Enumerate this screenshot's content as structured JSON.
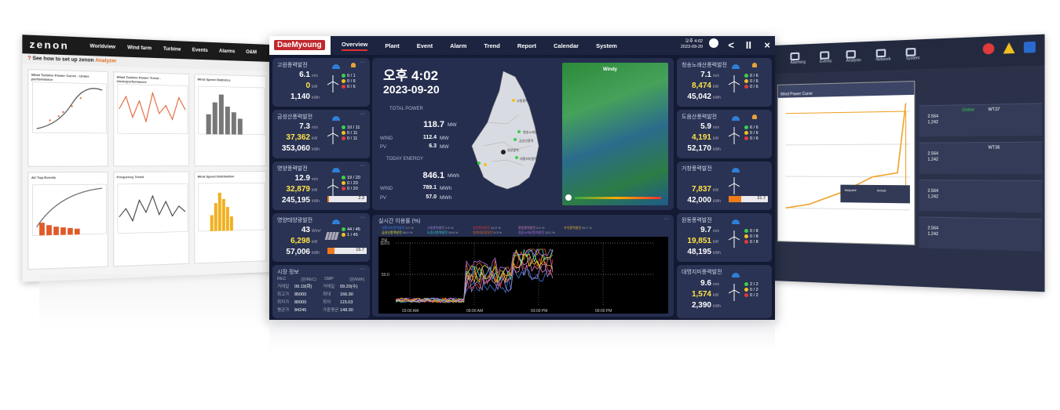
{
  "left_screen": {
    "logo": "zenon",
    "nav": [
      "Worldview",
      "Wind farm",
      "Turbine",
      "Events",
      "Alarms",
      "O&M"
    ],
    "subtitle": "See how to set up zenon",
    "subtitle_link": "Analyzer",
    "panels": [
      "Wind Turbine Power Curve - Under performance",
      "Wind Turbine Power Trend - Underperformance",
      "Wind Speed Statistics",
      "AV Top Events",
      "Frequency Trend",
      "Wind Speed Distribution"
    ]
  },
  "main": {
    "brand": "DaeMyoung",
    "nav": [
      "Overview",
      "Plant",
      "Event",
      "Alarm",
      "Trend",
      "Report",
      "Calendar",
      "System"
    ],
    "clock": {
      "time": "오후 4:02",
      "date": "2023-09-20"
    },
    "controls": {
      "back": "<",
      "pause": "II",
      "close": "×"
    },
    "left_cards": [
      {
        "name": "고원풍력발전",
        "v1": "6.1",
        "u1": "m/s",
        "v2": "0",
        "u2": "kW",
        "v3": "1,140",
        "u3": "kWh",
        "c": [
          "0",
          "0",
          "0"
        ],
        "t": [
          "1",
          "6",
          "6"
        ]
      },
      {
        "name": "금성산풍력발전",
        "v1": "7.3",
        "u1": "m/s",
        "v2": "37,362",
        "u2": "kW",
        "v3": "353,060",
        "u3": "kWh",
        "c": [
          "10",
          "0",
          "0"
        ],
        "t": [
          "11",
          "11",
          "11"
        ]
      },
      {
        "name": "영양풍력발전",
        "v1": "12.9",
        "u1": "m/s",
        "v2": "32,879",
        "u2": "kW",
        "v3": "245,195",
        "u3": "kWh",
        "c": [
          "19",
          "0",
          "0"
        ],
        "t": [
          "20",
          "20",
          "20"
        ],
        "bar": "2.3"
      },
      {
        "name": "영양태양광발전",
        "v1": "43",
        "u1": "W/m²",
        "v2": "6,298",
        "u2": "kW",
        "v3": "57,006",
        "u3": "kWh",
        "c": [
          "44",
          "1"
        ],
        "t": [
          "45",
          "45"
        ],
        "bar": "16.7"
      }
    ],
    "market": {
      "title": "시장 정보",
      "rec": "REC",
      "smp": "SMP",
      "rec_unit": "(원/REC)",
      "smp_unit": "(원/kWh)",
      "rows": [
        {
          "k1": "거래일",
          "v1": "09.19(화)",
          "k2": "거래일",
          "v2": "09.20(수)"
        },
        {
          "k1": "최고가",
          "v1": "85000",
          "k2": "최대",
          "v2": "166.90"
        },
        {
          "k1": "최저가",
          "v1": "80000",
          "k2": "최저",
          "v2": "115.03"
        },
        {
          "k1": "평균가",
          "v1": "84245",
          "k2": "가중평균",
          "v2": "148.90"
        }
      ]
    },
    "center": {
      "time": "오후 4:02",
      "date": "2023-09-20",
      "total_power_label": "TOTAL POWER",
      "total_power": "118.7",
      "total_power_unit": "MW",
      "wind_label": "WIND",
      "wind_power": "112.4",
      "wind_power_unit": "MW",
      "pv_label": "PV",
      "pv_power": "6.3",
      "pv_power_unit": "MW",
      "today_energy_label": "TODAY ENERGY",
      "today_energy": "846.1",
      "today_energy_unit": "MWh",
      "wind_energy": "789.1",
      "wind_energy_unit": "MWh",
      "pv_energy": "57.0",
      "pv_energy_unit": "MWh",
      "map_labels": [
        "고원풍력",
        "청송노래산풍력",
        "금성산풍력",
        "영양풍력",
        "대명지미풍력",
        "태양광"
      ],
      "weather_brand": "Windy"
    },
    "trend": {
      "title": "실시간 이용률 (%)",
      "legend": [
        {
          "name": "대명지미풍력발전",
          "value": "0.1 %",
          "color": "#3a7be0"
        },
        {
          "name": "고원풍력발전",
          "value": "2.6 %",
          "color": "#a58be0"
        },
        {
          "name": "영양풍력발전",
          "value": "42.2 %",
          "color": "#e03a3a"
        },
        {
          "name": "풍동풍력발전",
          "value": "5.0 %",
          "color": "#e080c0"
        },
        {
          "name": "가덕풍력발전",
          "value": "26.7 %",
          "color": "#f0b830"
        },
        {
          "name": "금성산풍력발전",
          "value": "46.0 %",
          "color": "#e8e830"
        },
        {
          "name": "도음산풍력발전",
          "value": "19.6 %",
          "color": "#3ad0d0"
        },
        {
          "name": "영양태양광발전",
          "value": "9.3 %",
          "color": "#e06a20"
        },
        {
          "name": "청송노래산풍력발전",
          "value": "15.1 %",
          "color": "#b070e0"
        }
      ],
      "y_unit": "[%]",
      "y_ticks": [
        "110.0",
        "50.0"
      ],
      "x_ticks": [
        "03:00 AM",
        "09:00 AM",
        "03:00 PM",
        "09:00 PM"
      ]
    },
    "right_cards": [
      {
        "name": "청송노래산풍력발전",
        "v1": "7.1",
        "u1": "m/s",
        "v2": "8,474",
        "u2": "kW",
        "v3": "45,042",
        "u3": "kWh",
        "c": [
          "0",
          "0",
          "0"
        ],
        "t": [
          "6",
          "6",
          "6"
        ]
      },
      {
        "name": "도음산풍력발전",
        "v1": "5.9",
        "u1": "m/s",
        "v2": "4,191",
        "u2": "kW",
        "v3": "52,170",
        "u3": "kWh",
        "c": [
          "6",
          "0",
          "0"
        ],
        "t": [
          "6",
          "6",
          "6"
        ]
      },
      {
        "name": "거창풍력발전",
        "v2": "7,837",
        "u2": "kW",
        "v3": "42,000",
        "u3": "kWh",
        "bar": "31.7"
      },
      {
        "name": "원동풍력발전",
        "v1": "9.7",
        "u1": "m/s",
        "v2": "19,851",
        "u2": "kW",
        "v3": "48,195",
        "u3": "kWh",
        "c": [
          "0",
          "0",
          "0"
        ],
        "t": [
          "8",
          "8",
          "8"
        ]
      },
      {
        "name": "대명지미풍력발전",
        "v1": "9.6",
        "u1": "m/s",
        "v2": "1,574",
        "u2": "kW",
        "v3": "2,390",
        "u3": "kWh",
        "c": [
          "2",
          "0",
          "0"
        ],
        "t": [
          "2",
          "2",
          "2"
        ]
      }
    ]
  },
  "right_screen": {
    "nav": [
      "Alarming",
      "Events",
      "Analysis",
      "Network",
      "System"
    ],
    "popup_title": "Wind Power Curve",
    "turbines": [
      "WT37",
      "WT36"
    ],
    "turbine_value": "2.564",
    "turbine_value2": "1.242",
    "units": [
      "MW",
      "MWh"
    ],
    "status": "Online",
    "legend": [
      "Setpoint",
      "Actual"
    ]
  },
  "colors": {
    "accent": "#e03030",
    "panel": "#2a3353",
    "bg": "#141a33",
    "orange": "#f07a1a",
    "yellow": "#ffe24a"
  }
}
